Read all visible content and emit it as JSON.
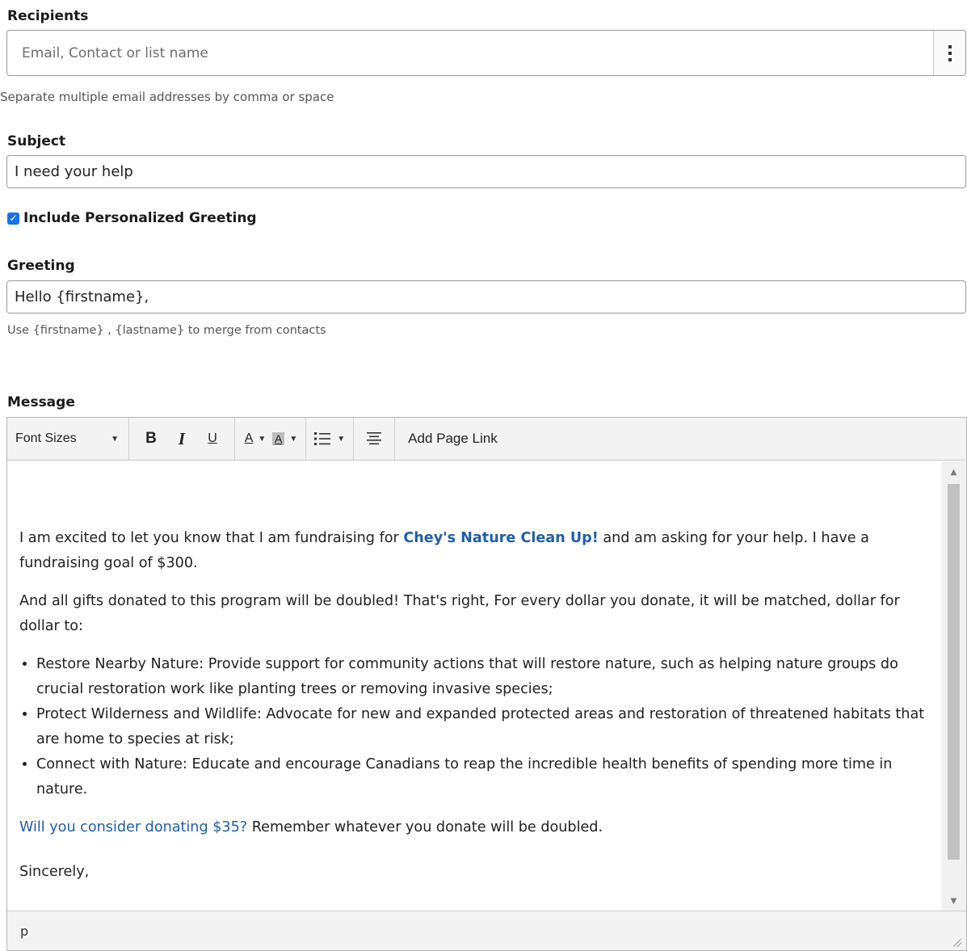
{
  "recipients": {
    "label": "Recipients",
    "placeholder": "Email, Contact or list name",
    "help": "Separate multiple email addresses by comma or space"
  },
  "subject": {
    "label": "Subject",
    "value": "I need your help"
  },
  "personalized_greeting": {
    "label": "Include Personalized Greeting",
    "checked": true
  },
  "greeting": {
    "label": "Greeting",
    "value": "Hello {firstname},",
    "help": "Use {firstname} , {lastname} to merge from contacts"
  },
  "message": {
    "label": "Message",
    "toolbar": {
      "font_sizes": "Font Sizes",
      "bold": "B",
      "italic": "I",
      "underline": "U",
      "font_color": "A",
      "bg_color": "A",
      "list_icon": "list-icon",
      "align_icon": "align-center-icon",
      "add_page_link": "Add Page Link"
    },
    "body": {
      "p1_before": "I am excited to let you know that I am fundraising for ",
      "p1_org": "Chey's Nature Clean Up!",
      "p1_after": " and am asking for your help.  I have a fundraising goal of $300.",
      "p2": "And all gifts donated to this program will be doubled! That's right, For every dollar you donate, it will be matched, dollar for dollar to:",
      "bullets": [
        "Restore Nearby Nature: Provide support for community actions that will restore nature, such as helping nature groups do crucial restoration work like planting trees or removing invasive species;",
        "Protect Wilderness and Wildlife: Advocate for new and expanded protected areas and restoration of threatened habitats that are home to species at risk;",
        "Connect with Nature: Educate and encourage Canadians to reap the incredible health benefits of spending more time in nature."
      ],
      "p3_link": "Will you consider donating $35?",
      "p3_after": " Remember whatever you donate will be doubled.",
      "p4": "Sincerely,"
    },
    "status_path": "p"
  }
}
